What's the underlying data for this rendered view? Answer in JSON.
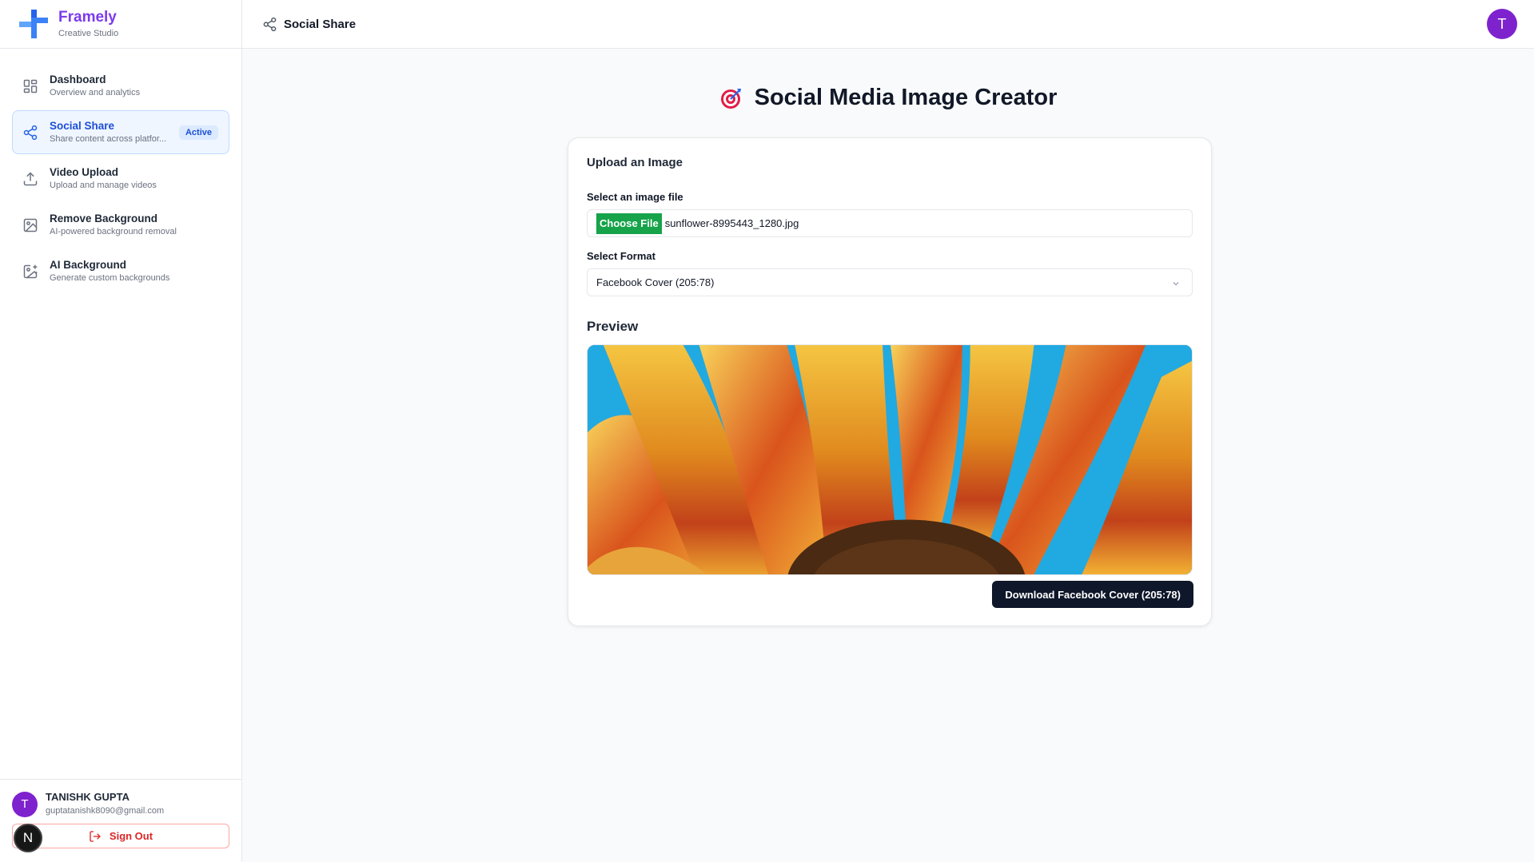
{
  "brand": {
    "name": "Framely",
    "subtitle": "Creative Studio"
  },
  "sidebar": {
    "items": [
      {
        "label": "Dashboard",
        "desc": "Overview and analytics",
        "icon": "grid-icon"
      },
      {
        "label": "Social Share",
        "desc": "Share content across platfor...",
        "icon": "share-icon",
        "badge": "Active"
      },
      {
        "label": "Video Upload",
        "desc": "Upload and manage videos",
        "icon": "upload-icon"
      },
      {
        "label": "Remove Background",
        "desc": "AI-powered background removal",
        "icon": "image-icon"
      },
      {
        "label": "AI Background",
        "desc": "Generate custom backgrounds",
        "icon": "image-plus-icon"
      }
    ]
  },
  "user": {
    "initial": "T",
    "name": "TANISHK GUPTA",
    "email": "guptatanishk8090@gmail.com",
    "signout_label": "Sign Out"
  },
  "dev_badge": "N",
  "header": {
    "title": "Social Share",
    "avatar_initial": "T"
  },
  "main": {
    "page_title": "Social Media Image Creator",
    "card": {
      "title": "Upload an Image",
      "file_label": "Select an image file",
      "choose_label": "Choose File",
      "file_name": "sunflower-8995443_1280.jpg",
      "format_label": "Select Format",
      "format_value": "Facebook Cover (205:78)",
      "preview_label": "Preview",
      "download_label": "Download Facebook Cover (205:78)"
    }
  },
  "colors": {
    "accent": "#7c3aed",
    "primary": "#2563eb",
    "choose_button": "#16a34a",
    "download_button": "#0f172a",
    "danger": "#dc2626"
  }
}
